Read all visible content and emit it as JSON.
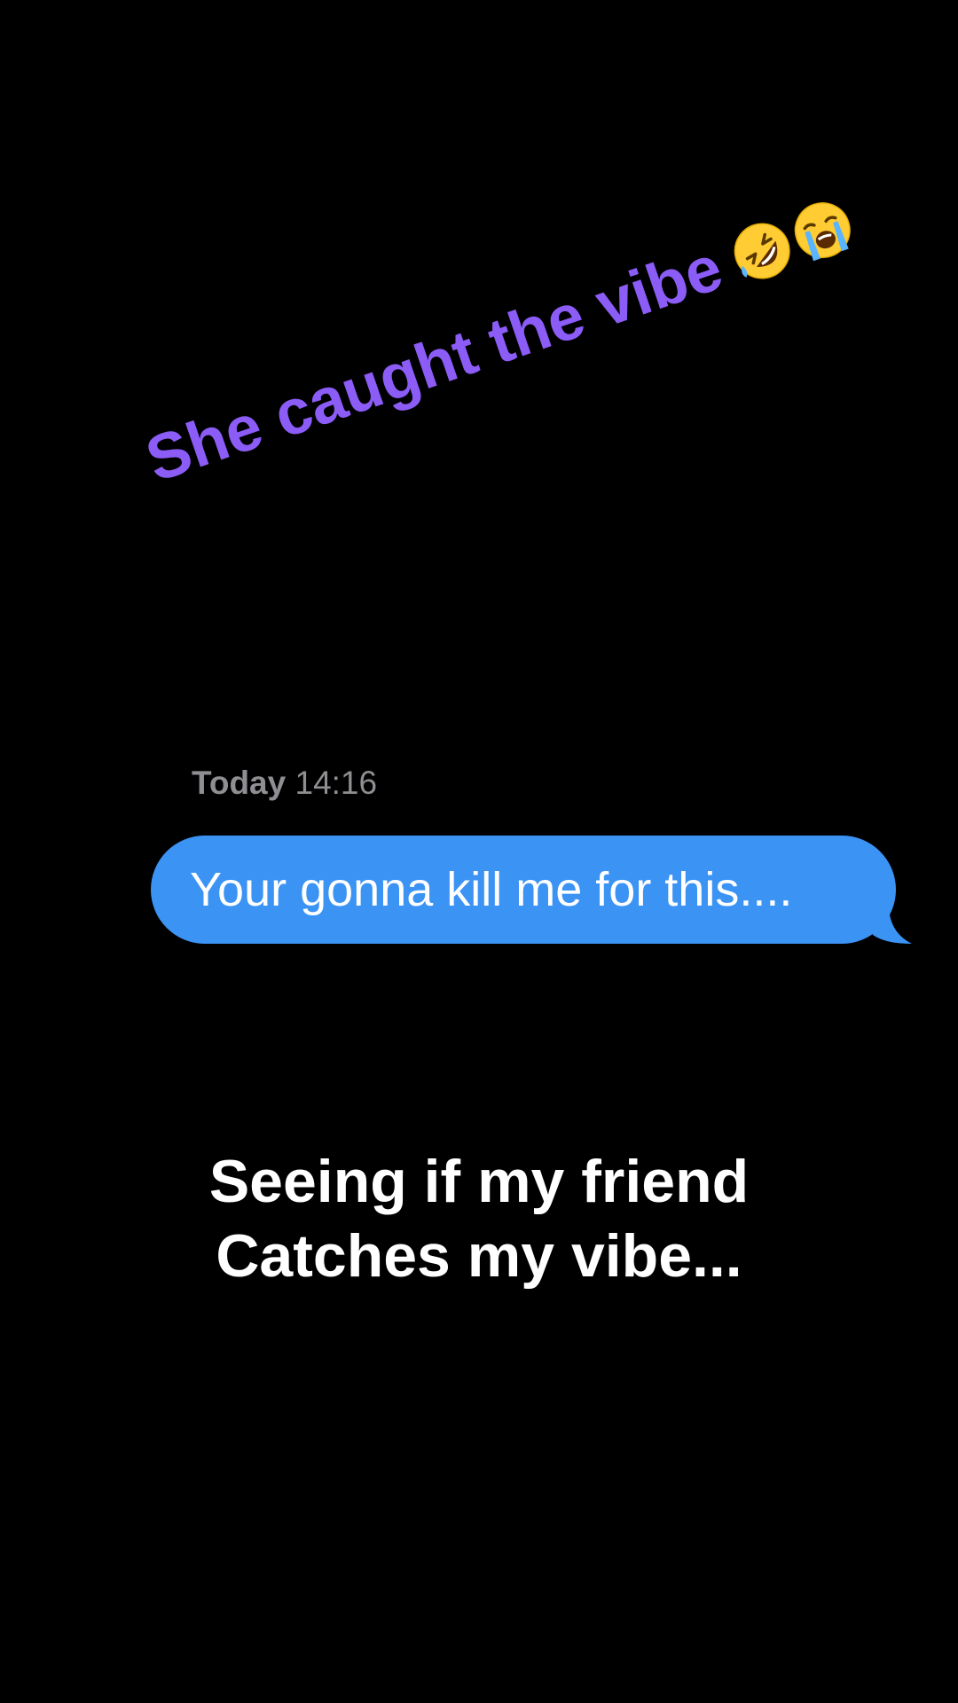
{
  "overlay": {
    "caption": "She caught the vibe",
    "caption_color": "#8b5cf6",
    "emojis": [
      "rolling-on-floor-laughing-emoji",
      "loudly-crying-face-emoji"
    ]
  },
  "conversation": {
    "timestamp_day": "Today",
    "timestamp_time": "14:16",
    "messages": [
      {
        "sender": "me",
        "text": "Your gonna kill me for this....",
        "bubble_color": "#3b93f4"
      }
    ]
  },
  "bottom_caption": {
    "lines": [
      "Seeing if my friend",
      "Catches my vibe..."
    ]
  },
  "colors": {
    "background": "#000000",
    "timestamp": "#8e8e93",
    "text_primary": "#ffffff"
  }
}
